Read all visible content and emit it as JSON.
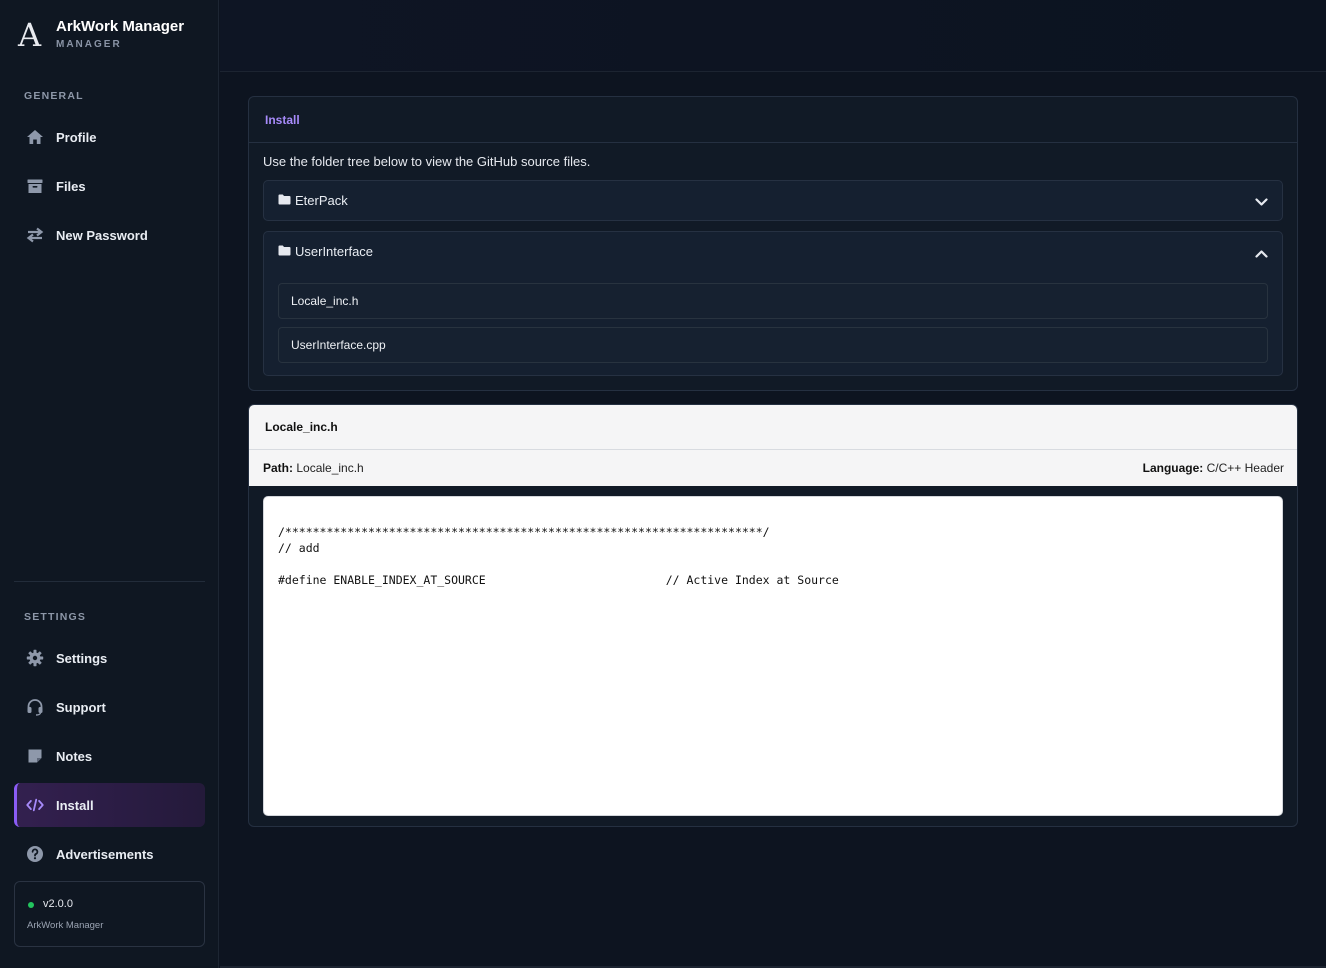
{
  "brand": {
    "logo_letter": "A",
    "title": "ArkWork Manager",
    "subtitle": "MANAGER"
  },
  "sidebar": {
    "general_label": "GENERAL",
    "general_items": [
      {
        "label": "Profile",
        "icon": "home-icon"
      },
      {
        "label": "Files",
        "icon": "archive-icon"
      },
      {
        "label": "New Password",
        "icon": "swap-arrows-icon"
      }
    ],
    "settings_label": "SETTINGS",
    "settings_items": [
      {
        "label": "Settings",
        "icon": "gear-icon"
      },
      {
        "label": "Support",
        "icon": "headset-icon"
      },
      {
        "label": "Notes",
        "icon": "sticky-note-icon"
      },
      {
        "label": "Install",
        "icon": "code-icon",
        "active": true
      },
      {
        "label": "Advertisements",
        "icon": "question-circle-icon"
      }
    ],
    "version": {
      "number": "v2.0.0",
      "app": "ArkWork Manager",
      "status_color": "#22c55e"
    }
  },
  "install_panel": {
    "title": "Install",
    "description": "Use the folder tree below to view the GitHub source files.",
    "folders": [
      {
        "name": "EterPack",
        "expanded": false,
        "files": []
      },
      {
        "name": "UserInterface",
        "expanded": true,
        "files": [
          "Locale_inc.h",
          "UserInterface.cpp"
        ]
      }
    ]
  },
  "viewer": {
    "title": "Locale_inc.h",
    "path_label": "Path:",
    "path_value": "Locale_inc.h",
    "language_label": "Language:",
    "language_value": "C/C++ Header",
    "code": "/*********************************************************************/\n// add\n\n#define ENABLE_INDEX_AT_SOURCE                          // Active Index at Source"
  },
  "colors": {
    "accent": "#a78bfa",
    "active_border": "#8b5cf6",
    "background": "#0d1420"
  }
}
